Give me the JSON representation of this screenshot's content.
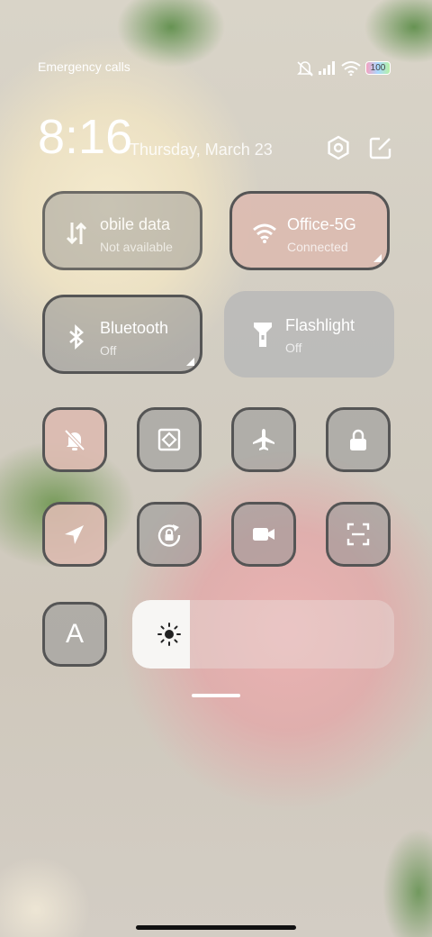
{
  "status_bar": {
    "carrier_text": "Emergency calls",
    "battery": "100"
  },
  "header": {
    "time": "8:16",
    "date": "Thursday, March 23"
  },
  "tiles": {
    "mobile_data": {
      "title": "obile data",
      "subtitle": "Not available"
    },
    "wifi": {
      "title": "Office-5G",
      "subtitle": "Connected"
    },
    "bluetooth": {
      "title": "Bluetooth",
      "subtitle": "Off"
    },
    "flashlight": {
      "title": "Flashlight",
      "subtitle": "Off"
    }
  },
  "toggles": [
    {
      "icon": "mute-bell-icon",
      "state": "on"
    },
    {
      "icon": "screen-cast-icon",
      "state": "off"
    },
    {
      "icon": "airplane-icon",
      "state": "off"
    },
    {
      "icon": "lock-icon",
      "state": "off"
    },
    {
      "icon": "location-icon",
      "state": "on"
    },
    {
      "icon": "rotation-lock-icon",
      "state": "off"
    },
    {
      "icon": "video-icon",
      "state": "off"
    },
    {
      "icon": "scanner-icon",
      "state": "off"
    }
  ],
  "auto_brightness": {
    "label": "A"
  },
  "brightness_level": 0.22,
  "colors": {
    "accent_pink": "#dbbab0",
    "tile_gray": "#969696",
    "border": "#555555"
  }
}
